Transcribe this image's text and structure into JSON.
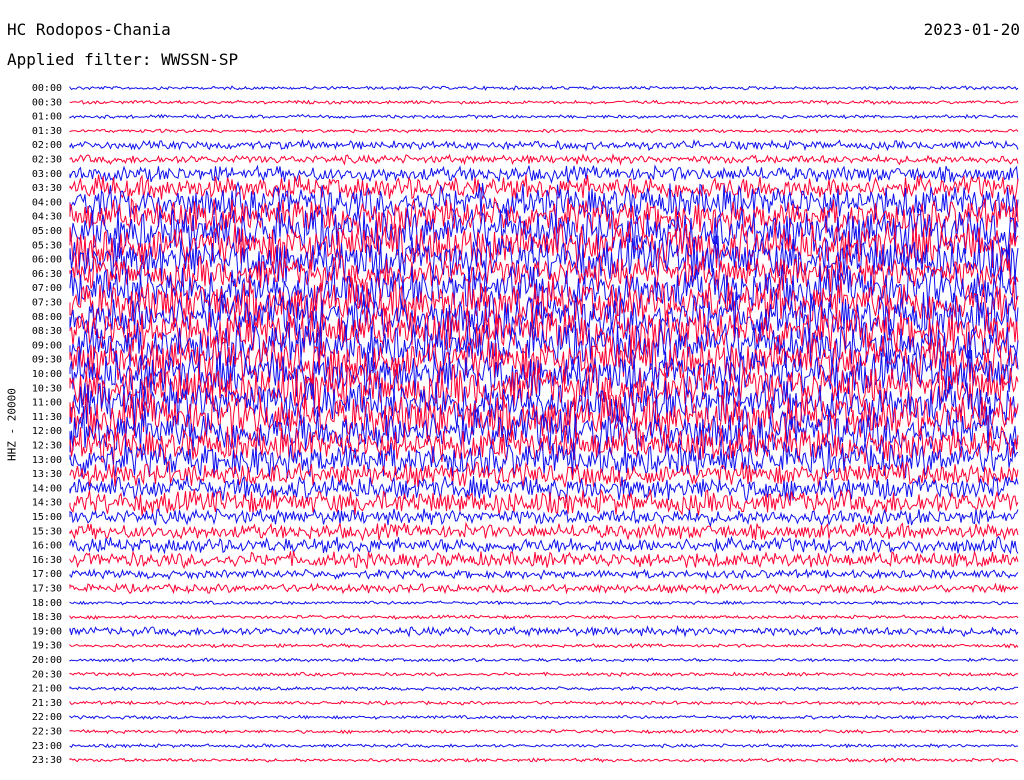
{
  "header": {
    "station": "HC Rodopos-Chania",
    "filter": "Applied filter: WWSSN-SP",
    "date": "2023-01-20"
  },
  "axis": {
    "channel_label": "HHZ - 20000"
  },
  "chart_data": {
    "type": "line",
    "title": "HC Rodopos-Chania",
    "subtitle": "Applied filter: WWSSN-SP",
    "date": "2023-01-20",
    "ylabel": "HHZ - 20000",
    "row_labels": [
      "00:00",
      "00:30",
      "01:00",
      "01:30",
      "02:00",
      "02:30",
      "03:00",
      "03:30",
      "04:00",
      "04:30",
      "05:00",
      "05:30",
      "06:00",
      "06:30",
      "07:00",
      "07:30",
      "08:00",
      "08:30",
      "09:00",
      "09:30",
      "10:00",
      "10:30",
      "11:00",
      "11:30",
      "12:00",
      "12:30",
      "13:00",
      "13:30",
      "14:00",
      "14:30",
      "15:00",
      "15:30",
      "16:00",
      "16:30",
      "17:00",
      "17:30",
      "18:00",
      "18:30",
      "19:00",
      "19:30",
      "20:00",
      "20:30",
      "21:00",
      "21:30",
      "22:00",
      "22:30",
      "23:00",
      "23:30"
    ],
    "trace_colors": [
      "#1010ee",
      "#ff0033"
    ],
    "row_amplitude_level": [
      1,
      1,
      1,
      1,
      2,
      2,
      3,
      4,
      5,
      5,
      6,
      6,
      6,
      5,
      6,
      6,
      6,
      6,
      6,
      6,
      6,
      6,
      6,
      6,
      6,
      5,
      5,
      4,
      4,
      4,
      3,
      3,
      3,
      3,
      2,
      2,
      1,
      1,
      2,
      1,
      1,
      1,
      1,
      1,
      1,
      1,
      1,
      1
    ]
  }
}
